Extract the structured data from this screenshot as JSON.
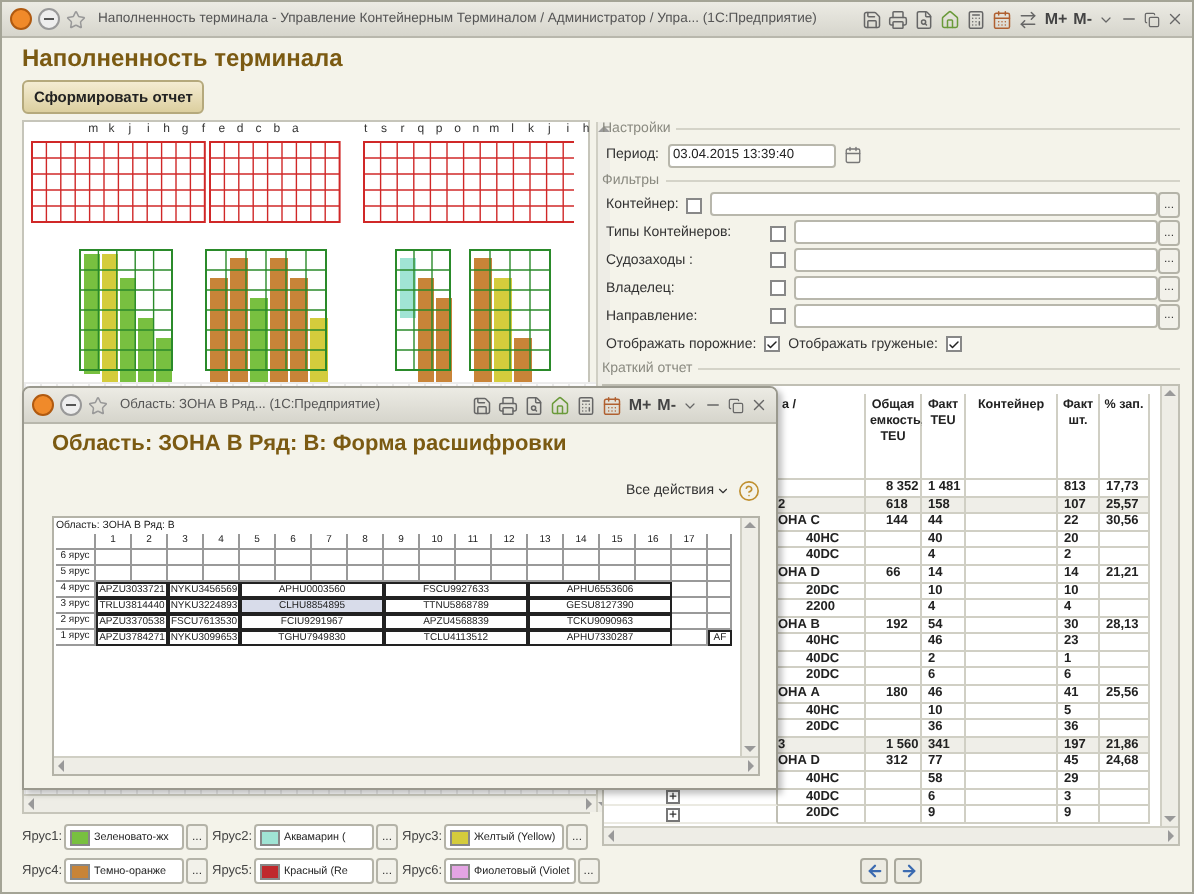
{
  "window": {
    "title": "Наполненность терминала - Управление Контейнерным Терминалом / Администратор / Упра...  (1С:Предприятие)",
    "toolbar": [
      "M+",
      "M-"
    ]
  },
  "form": {
    "title": "Наполненность терминала",
    "generate_button": "Сформировать отчет"
  },
  "yard_map": {
    "letters_left": [
      "m",
      "k",
      "j",
      "i",
      "h",
      "g",
      "f",
      "e",
      "d",
      "c",
      "b",
      "a"
    ],
    "letters_right": [
      "t",
      "s",
      "r",
      "q",
      "p",
      "o",
      "n",
      "m",
      "l",
      "k",
      "j",
      "i",
      "h"
    ]
  },
  "legend": [
    {
      "label": "Ярус1:",
      "value": "Зеленовато-жх",
      "color": "#78c040",
      "button": "..."
    },
    {
      "label": "Ярус2:",
      "value": "Аквамарин (",
      "color": "#a0e4d4",
      "button": "..."
    },
    {
      "label": "Ярус3:",
      "value": "Желтый (Yellow)",
      "color": "#d4cc3c",
      "button": "..."
    },
    {
      "label": "Ярус4:",
      "value": "Темно-оранже",
      "color": "#c88438",
      "button": "..."
    },
    {
      "label": "Ярус5:",
      "value": "Красный (Re",
      "color": "#c0282c",
      "button": "..."
    },
    {
      "label": "Ярус6:",
      "value": "Фиолетовый (Violet",
      "color": "#e4a4e4",
      "button": "..."
    }
  ],
  "settings": {
    "group": "Настройки",
    "period_label": "Период:",
    "period_value": "03.04.2015 13:39:40"
  },
  "filters": {
    "group": "Фильтры",
    "items": [
      {
        "label": "Контейнер:",
        "checked": false,
        "button": "..."
      },
      {
        "label": "Типы Контейнеров:",
        "checked": false,
        "button": "..."
      },
      {
        "label": "Судозаходы :",
        "checked": false,
        "button": "..."
      },
      {
        "label": "Владелец:",
        "checked": false,
        "button": "..."
      },
      {
        "label": "Направление:",
        "checked": false,
        "button": "..."
      }
    ],
    "show_empty": {
      "label": "Отображать порожние:",
      "checked": true
    },
    "show_loaded": {
      "label": "Отображать груженые:",
      "checked": true
    }
  },
  "report": {
    "group": "Краткий отчет",
    "columns": [
      "а /",
      "Общая емкость, TEU",
      "Факт TEU",
      "Контейнер",
      "Факт шт.",
      "% зап."
    ],
    "rows": [
      {
        "kind": "total",
        "capacity": "8 352",
        "teu": "1 481",
        "count": "813",
        "percent": "17,73"
      },
      {
        "kind": "row",
        "label": "2",
        "capacity": "618",
        "teu": "158",
        "count": "107",
        "percent": "25,57"
      },
      {
        "kind": "zone",
        "label": "ОНА С",
        "capacity": "144",
        "teu": "44",
        "count": "22",
        "percent": "30,56"
      },
      {
        "kind": "type",
        "label": "40HC",
        "teu": "40",
        "count": "20"
      },
      {
        "kind": "type",
        "label": "40DC",
        "teu": "4",
        "count": "2"
      },
      {
        "kind": "zone",
        "label": "ОНА D",
        "capacity": "66",
        "teu": "14",
        "count": "14",
        "percent": "21,21"
      },
      {
        "kind": "type",
        "label": "20DC",
        "teu": "10",
        "count": "10"
      },
      {
        "kind": "type",
        "label": "2200",
        "teu": "4",
        "count": "4"
      },
      {
        "kind": "zone",
        "label": "ОНА В",
        "capacity": "192",
        "teu": "54",
        "count": "30",
        "percent": "28,13"
      },
      {
        "kind": "type",
        "label": "40HC",
        "teu": "46",
        "count": "23"
      },
      {
        "kind": "type",
        "label": "40DC",
        "teu": "2",
        "count": "1"
      },
      {
        "kind": "type",
        "label": "20DC",
        "teu": "6",
        "count": "6"
      },
      {
        "kind": "zone",
        "label": "ОНА А",
        "capacity": "180",
        "teu": "46",
        "count": "41",
        "percent": "25,56"
      },
      {
        "kind": "type",
        "label": "40HC",
        "teu": "10",
        "count": "5"
      },
      {
        "kind": "type",
        "label": "20DC",
        "teu": "36",
        "count": "36"
      },
      {
        "kind": "row",
        "label": "3",
        "capacity": "1 560",
        "teu": "341",
        "count": "197",
        "percent": "21,86"
      },
      {
        "kind": "zone",
        "label": "ОНА D",
        "capacity": "312",
        "teu": "77",
        "count": "45",
        "percent": "24,68"
      },
      {
        "kind": "type",
        "label": "40HC",
        "teu": "58",
        "count": "29"
      },
      {
        "kind": "type",
        "label": "40DC",
        "expanded": false,
        "teu": "6",
        "count": "3"
      },
      {
        "kind": "type",
        "label": "20DC",
        "expanded": false,
        "teu": "9",
        "count": "9"
      }
    ]
  },
  "popup": {
    "title": "Область: ЗОНА В Ряд...  (1С:Предприятие)",
    "toolbar": [
      "M+",
      "M-"
    ],
    "heading": "Область: ЗОНА В Ряд: В: Форма расшифровки",
    "actions": "Все действия",
    "caption": "Область: ЗОНА В Ряд: В",
    "columns": [
      "1",
      "2",
      "3",
      "4",
      "5",
      "6",
      "7",
      "8",
      "9",
      "10",
      "11",
      "12",
      "13",
      "14",
      "15",
      "16",
      "17"
    ],
    "rows": [
      {
        "label": "6 ярус"
      },
      {
        "label": "5 ярус"
      },
      {
        "label": "4 ярус",
        "cells": [
          {
            "text": "APZU3033721",
            "kind": "pair",
            "selected": false
          },
          {
            "text": "NYKU3456569",
            "kind": "pair",
            "selected": false
          },
          {
            "text": "APHU0003560",
            "kind": "block",
            "selected": false
          },
          {
            "text": "FSCU9927633",
            "kind": "block",
            "selected": false
          },
          {
            "text": "APHU6553606",
            "kind": "block",
            "selected": false
          }
        ]
      },
      {
        "label": "3 ярус",
        "cells": [
          {
            "text": "TRLU3814440",
            "kind": "pair",
            "selected": false
          },
          {
            "text": "NYKU3224893",
            "kind": "pair",
            "selected": false
          },
          {
            "text": "CLHU8854895",
            "kind": "block",
            "selected": true
          },
          {
            "text": "TTNU5868789",
            "kind": "block",
            "selected": false
          },
          {
            "text": "GESU8127390",
            "kind": "block",
            "selected": false
          }
        ]
      },
      {
        "label": "2 ярус",
        "cells": [
          {
            "text": "APZU3370538",
            "kind": "pair",
            "selected": false
          },
          {
            "text": "FSCU7613530",
            "kind": "pair",
            "selected": false
          },
          {
            "text": "FCIU9291967",
            "kind": "block",
            "selected": false
          },
          {
            "text": "APZU4568839",
            "kind": "block",
            "selected": false
          },
          {
            "text": "TCKU9090963",
            "kind": "block",
            "selected": false
          }
        ]
      },
      {
        "label": "1 ярус",
        "cells": [
          {
            "text": "APZU3784271",
            "kind": "pair",
            "selected": false
          },
          {
            "text": "NYKU3099653",
            "kind": "pair",
            "selected": false
          },
          {
            "text": "TGHU7949830",
            "kind": "block",
            "selected": false
          },
          {
            "text": "TCLU4113512",
            "kind": "block",
            "selected": false
          },
          {
            "text": "APHU7330287",
            "kind": "block",
            "selected": false
          },
          {
            "text": "AF",
            "kind": "edge",
            "selected": false
          }
        ]
      }
    ]
  }
}
